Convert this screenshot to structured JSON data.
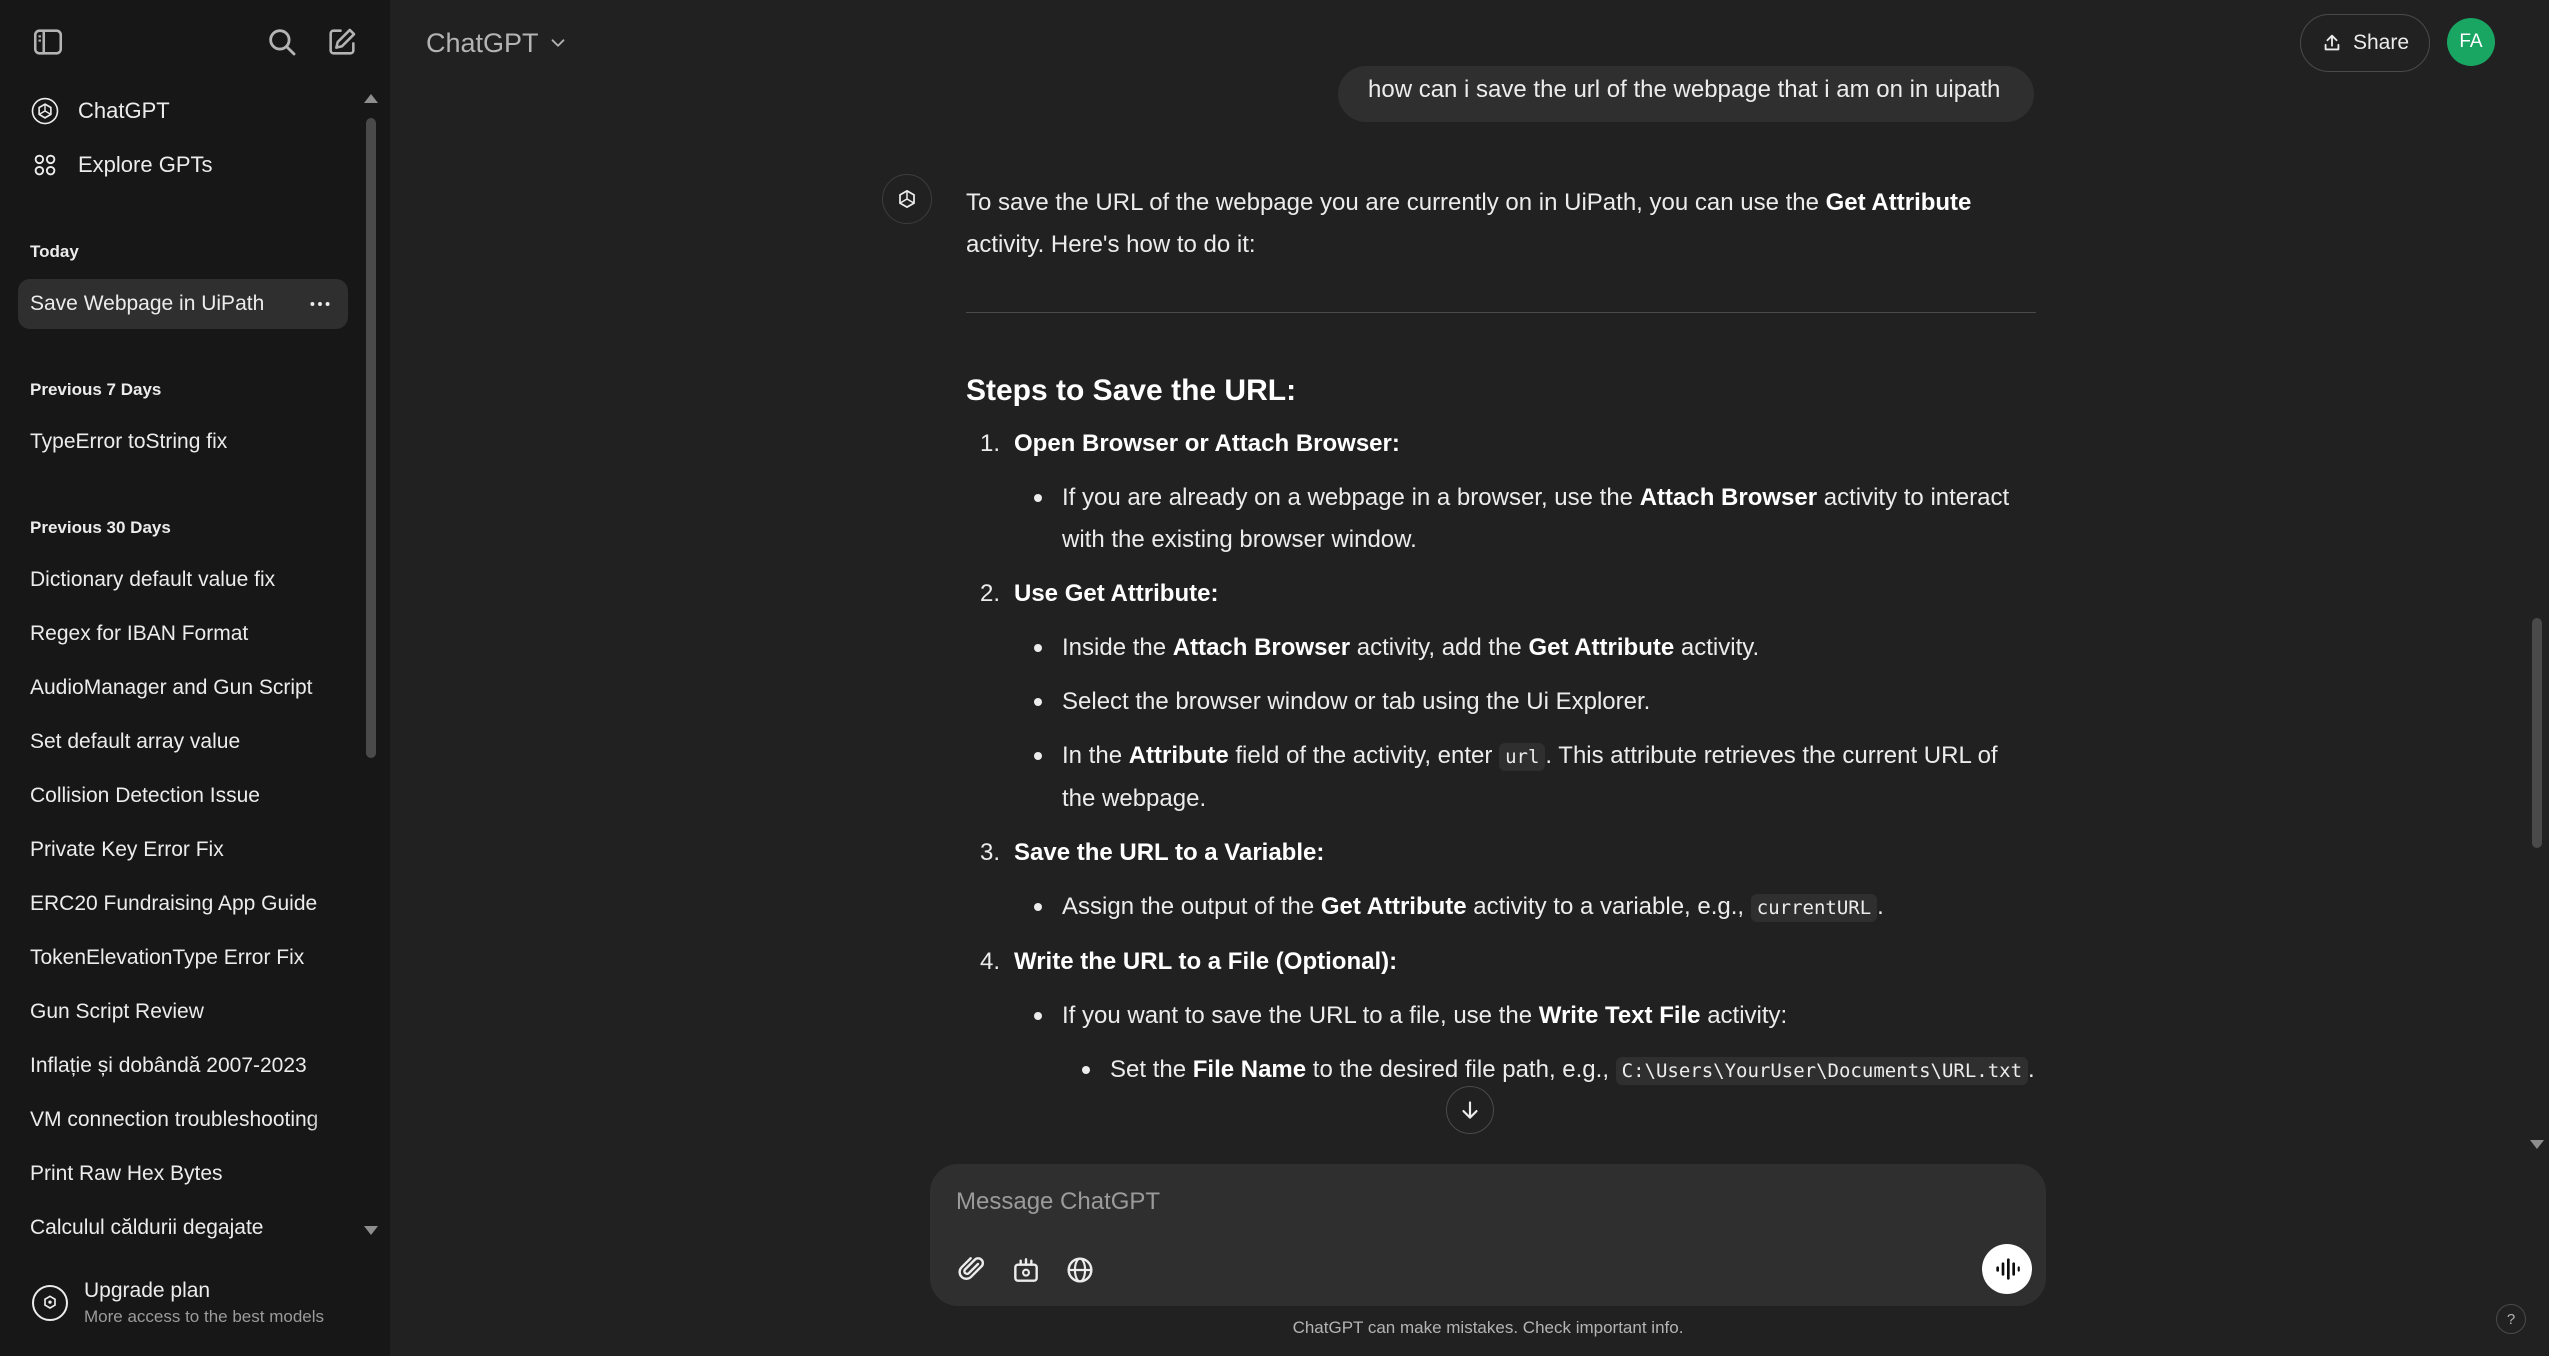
{
  "sidebar": {
    "nav": [
      {
        "label": "ChatGPT",
        "icon": "openai-logo-icon"
      },
      {
        "label": "Explore GPTs",
        "icon": "grid-icon"
      }
    ],
    "sections": [
      {
        "title": "Today",
        "items": [
          "Save Webpage in UiPath"
        ]
      },
      {
        "title": "Previous 7 Days",
        "items": [
          "TypeError toString fix"
        ]
      },
      {
        "title": "Previous 30 Days",
        "items": [
          "Dictionary default value fix",
          "Regex for IBAN Format",
          "AudioManager and Gun Script",
          "Set default array value",
          "Collision Detection Issue",
          "Private Key Error Fix",
          "ERC20 Fundraising App Guide",
          "TokenElevationType Error Fix",
          "Gun Script Review",
          "Inflație și dobândă 2007-2023",
          "VM connection troubleshooting",
          "Print Raw Hex Bytes",
          "Calculul căldurii degajate"
        ]
      }
    ],
    "upgrade": {
      "title": "Upgrade plan",
      "subtitle": "More access to the best models"
    }
  },
  "header": {
    "model": "ChatGPT",
    "share": "Share",
    "avatar_initials": "FA"
  },
  "chat": {
    "user_message": "how can i save the url of the webpage that i am on in uipath",
    "intro": {
      "p1": "To save the URL of the webpage you are currently on in UiPath, you can use the ",
      "b1": "Get Attribute",
      "p2": " activity. Here's how to do it:"
    },
    "heading": "Steps to Save the URL:",
    "steps": [
      {
        "num": "1.",
        "title": "Open Browser or Attach Browser",
        "bullets": [
          {
            "a": "If you are already on a webpage in a browser, use the ",
            "b": "Attach Browser",
            "c": " activity to interact with the existing browser window."
          }
        ]
      },
      {
        "num": "2.",
        "title": "Use Get Attribute",
        "bullets": [
          {
            "a": "Inside the ",
            "b": "Attach Browser",
            "c": " activity, add the ",
            "d": "Get Attribute",
            "e": " activity."
          },
          {
            "a": "Select the browser window or tab using the Ui Explorer."
          },
          {
            "a": "In the ",
            "b": "Attribute",
            "c": " field of the activity, enter ",
            "code": "url",
            "d": ". This attribute retrieves the current URL of the webpage."
          }
        ]
      },
      {
        "num": "3.",
        "title": "Save the URL to a Variable",
        "bullets": [
          {
            "a": "Assign the output of the ",
            "b": "Get Attribute",
            "c": " activity to a variable, e.g., ",
            "code": "currentURL",
            "d": "."
          }
        ]
      },
      {
        "num": "4.",
        "title": "Write the URL to a File (Optional)",
        "bullets": [
          {
            "a": "If you want to save the URL to a file, use the ",
            "b": "Write Text File",
            "c": " activity:"
          }
        ],
        "sub_bullets": [
          {
            "a": "Set the ",
            "b": "File Name",
            "c": " to the desired file path, e.g., ",
            "code": "C:\\Users\\YourUser\\Documents\\URL.txt",
            "d": "."
          }
        ]
      }
    ]
  },
  "composer": {
    "placeholder": "Message ChatGPT",
    "tools": [
      "paperclip-icon",
      "canvas-icon",
      "globe-icon"
    ],
    "voice": "voice-mode-icon"
  },
  "footer": {
    "disclaimer": "ChatGPT can make mistakes. Check important info.",
    "help": "?"
  }
}
